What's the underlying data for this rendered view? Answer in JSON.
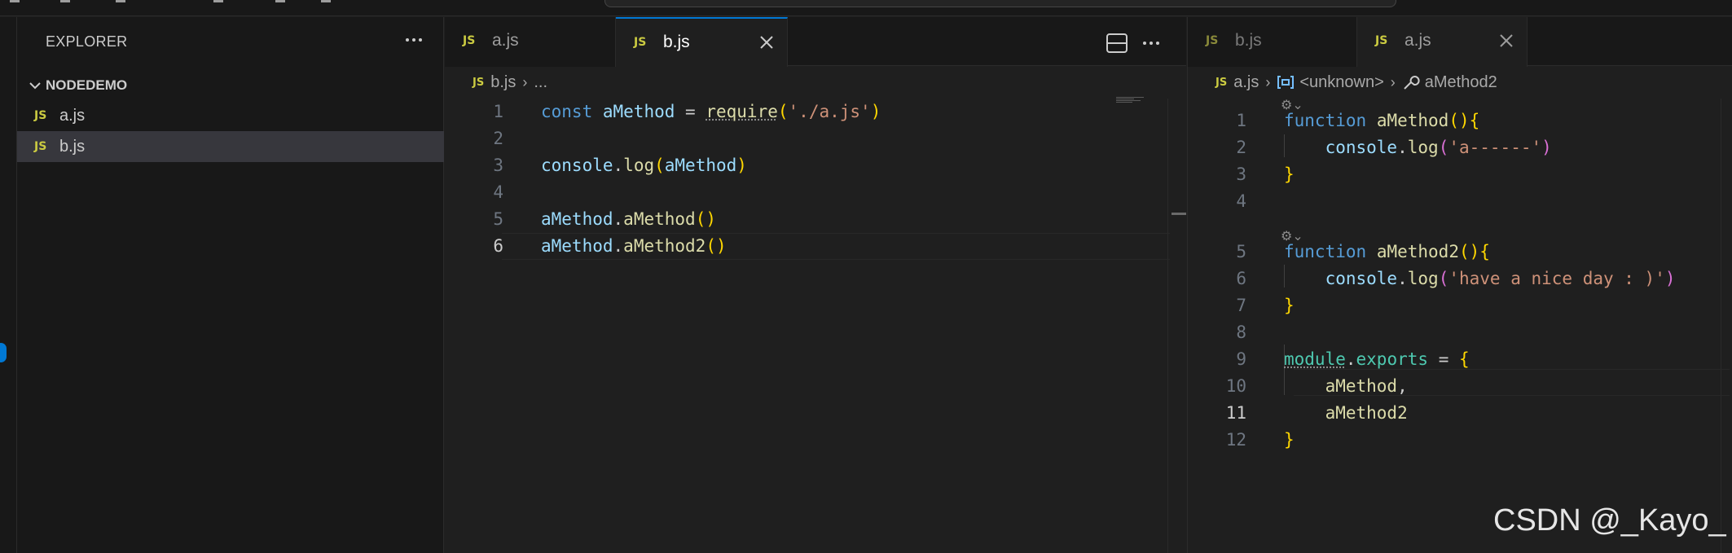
{
  "sidebar": {
    "title": "EXPLORER",
    "folder": "NODEDEMO",
    "files": [
      {
        "badge": "JS",
        "name": "a.js"
      },
      {
        "badge": "JS",
        "name": "b.js"
      }
    ]
  },
  "left_editor": {
    "tabs": [
      {
        "badge": "JS",
        "label": "a.js"
      },
      {
        "badge": "JS",
        "label": "b.js"
      }
    ],
    "breadcrumb": {
      "badge": "JS",
      "file": "b.js",
      "rest": "..."
    },
    "line_numbers": [
      "1",
      "2",
      "3",
      "4",
      "5",
      "6"
    ],
    "code": [
      "const aMethod = require('./a.js')",
      "",
      "console.log(aMethod)",
      "",
      "aMethod.aMethod()",
      "aMethod.aMethod2()"
    ]
  },
  "right_editor": {
    "tabs": [
      {
        "badge": "JS",
        "label": "b.js"
      },
      {
        "badge": "JS",
        "label": "a.js"
      }
    ],
    "breadcrumb": {
      "badge": "JS",
      "file": "a.js",
      "symbol1": "<unknown>",
      "symbol2": "aMethod2"
    },
    "codelens": [
      "⚙︎⌄",
      "⚙︎⌄"
    ],
    "line_numbers": [
      "1",
      "2",
      "3",
      "4",
      "5",
      "6",
      "7",
      "8",
      "9",
      "10",
      "11",
      "12"
    ],
    "code": [
      "function aMethod(){",
      "    console.log('a------')",
      "}",
      "",
      "function aMethod2(){",
      "    console.log('have a nice day : )')",
      "}",
      "",
      "module.exports = {",
      "    aMethod,",
      "    aMethod2",
      "}"
    ]
  },
  "watermark": "CSDN @_Kayo_",
  "colors": {
    "accent": "#0078d4",
    "keyword": "#569cd6",
    "function": "#dcdcaa",
    "variable": "#9cdcfe",
    "string": "#ce9178",
    "bracket": "#ffd700",
    "bracket2": "#da70d6",
    "module": "#4ec9b0"
  },
  "icons": {
    "close": "close-icon",
    "more": "ellipsis-icon",
    "split": "split-editor-icon",
    "chevron": "chevron-down-icon",
    "wrench": "wrench-icon",
    "symbol": "symbol-variable-icon"
  }
}
